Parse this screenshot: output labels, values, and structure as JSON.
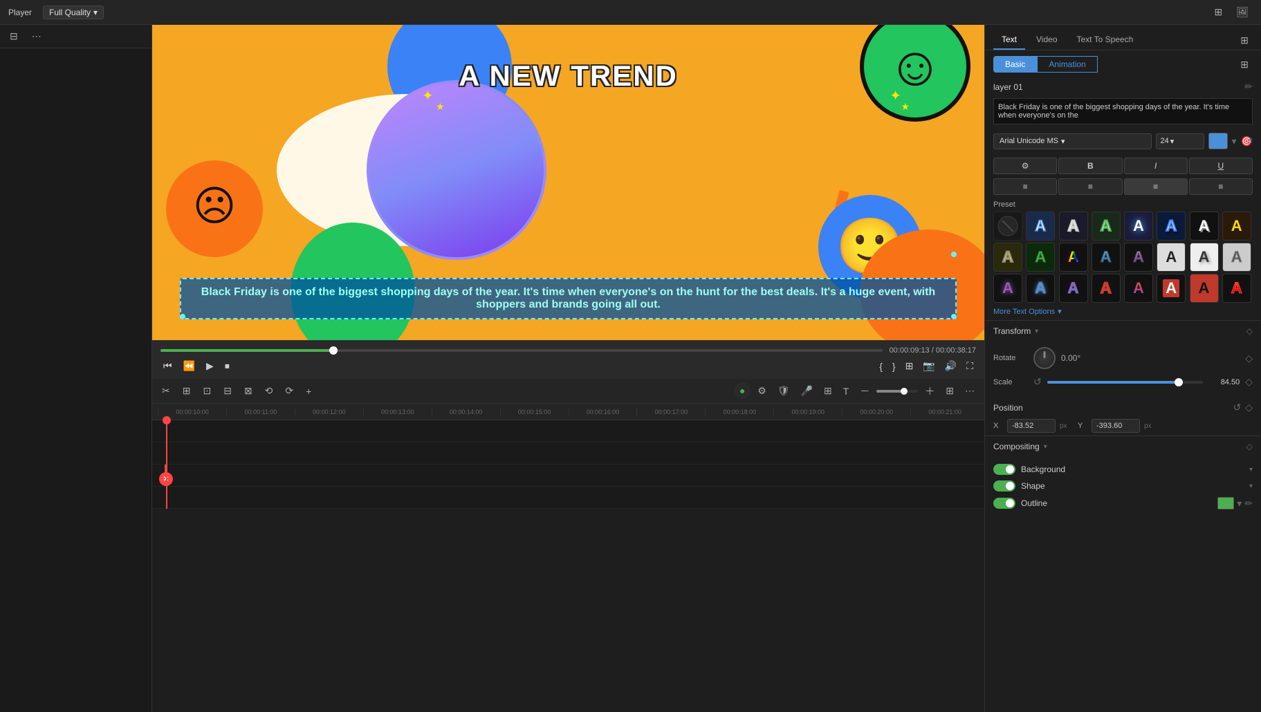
{
  "topbar": {
    "player_label": "Player",
    "quality_label": "Full Quality",
    "quality_dropdown_arrow": "▾"
  },
  "left_panel": {
    "filter_icon": "≡",
    "more_icon": "⋯"
  },
  "video_controls": {
    "current_time": "00:00:09:13",
    "separator": "/",
    "total_time": "00:00:38:17",
    "progress_percent": 24
  },
  "right_panel": {
    "tabs": [
      "Text",
      "Video",
      "Text To Speech"
    ],
    "active_tab": "Text",
    "sub_tabs": [
      "Basic",
      "Animation"
    ],
    "active_sub_tab": "Basic",
    "sub_tab_label": "Basic Animation",
    "layer_label": "layer 01",
    "text_content": "Black Friday is one of the biggest shopping days of the year. It's time when everyone's on the",
    "font_family": "Arial Unicode MS",
    "font_size": "24",
    "format_buttons": [
      "B",
      "I",
      "U"
    ],
    "align_buttons": [
      "≡",
      "≡",
      "≡",
      "≡"
    ],
    "preset_label": "Preset",
    "more_text_options": "More Text Options",
    "preset_items": [
      {
        "label": "A",
        "style": "disabled"
      },
      {
        "label": "A",
        "style": "outline-blue"
      },
      {
        "label": "A",
        "style": "outline-white"
      },
      {
        "label": "A",
        "style": "glow-white"
      },
      {
        "label": "A",
        "style": "shadow-blue"
      },
      {
        "label": "A",
        "style": "outline-blue2"
      },
      {
        "label": "A",
        "style": "plain-white"
      },
      {
        "label": "A",
        "style": "gold"
      },
      {
        "label": "A",
        "style": "yellow"
      },
      {
        "label": "A",
        "style": "green-outline"
      },
      {
        "label": "A",
        "style": "rainbow"
      },
      {
        "label": "A",
        "style": "gradient-blue"
      },
      {
        "label": "A",
        "style": "gradient-purple"
      },
      {
        "label": "A",
        "style": "dark"
      },
      {
        "label": "A",
        "style": "dark2"
      },
      {
        "label": "A",
        "style": "dark-shadow"
      },
      {
        "label": "A",
        "style": "purple-glow"
      },
      {
        "label": "A",
        "style": "blue-glow"
      },
      {
        "label": "A",
        "style": "purple-outline"
      },
      {
        "label": "A",
        "style": "red-outline"
      },
      {
        "label": "A",
        "style": "red-glow"
      },
      {
        "label": "A",
        "style": "red-bg"
      },
      {
        "label": "A",
        "style": "red-dark"
      },
      {
        "label": "A",
        "style": "red-fire"
      }
    ],
    "transform_section": "Transform",
    "rotate_label": "Rotate",
    "rotate_value": "0.00°",
    "scale_label": "Scale",
    "scale_value": "84.50",
    "scale_percent": 84.5,
    "position_label": "Position",
    "pos_x_label": "X",
    "pos_x_value": "-83.52",
    "pos_y_label": "Y",
    "pos_y_value": "-393.60",
    "pos_unit": "px",
    "compositing_label": "Compositing",
    "background_label": "Background",
    "shape_label": "Shape",
    "outline_label": "Outline",
    "outline_color": "#4caf50"
  },
  "timeline": {
    "ruler_marks": [
      "00:00:10:00",
      "00:00:11:00",
      "00:00:12:00",
      "00:00:13:00",
      "00:00:14:00",
      "00:00:15:00",
      "00:00:16:00",
      "00:00:17:00",
      "00:00:18:00",
      "00:00:19:00",
      "00:00:20:00",
      "00:00:21:00"
    ]
  },
  "preview": {
    "title": "A NEW TREND",
    "body_text": "Black Friday is one of the biggest shopping days of the year. It's time when everyone's on the hunt for the best deals. It's a huge event, with shoppers and brands going all out."
  },
  "toolbar_tools": [
    "✂",
    "⊞",
    "⊡",
    "⊟",
    "⊠",
    "⟲",
    "⟳",
    "+"
  ],
  "icons": {
    "prev_frame": "⏮",
    "step_back": "⏪",
    "play": "▶",
    "stop": "⏹",
    "bracket_open": "{",
    "bracket_close": "}",
    "expand": "⛶",
    "camera": "📷",
    "speaker": "🔊",
    "fullscreen": "⛶",
    "pip": "⊞"
  }
}
